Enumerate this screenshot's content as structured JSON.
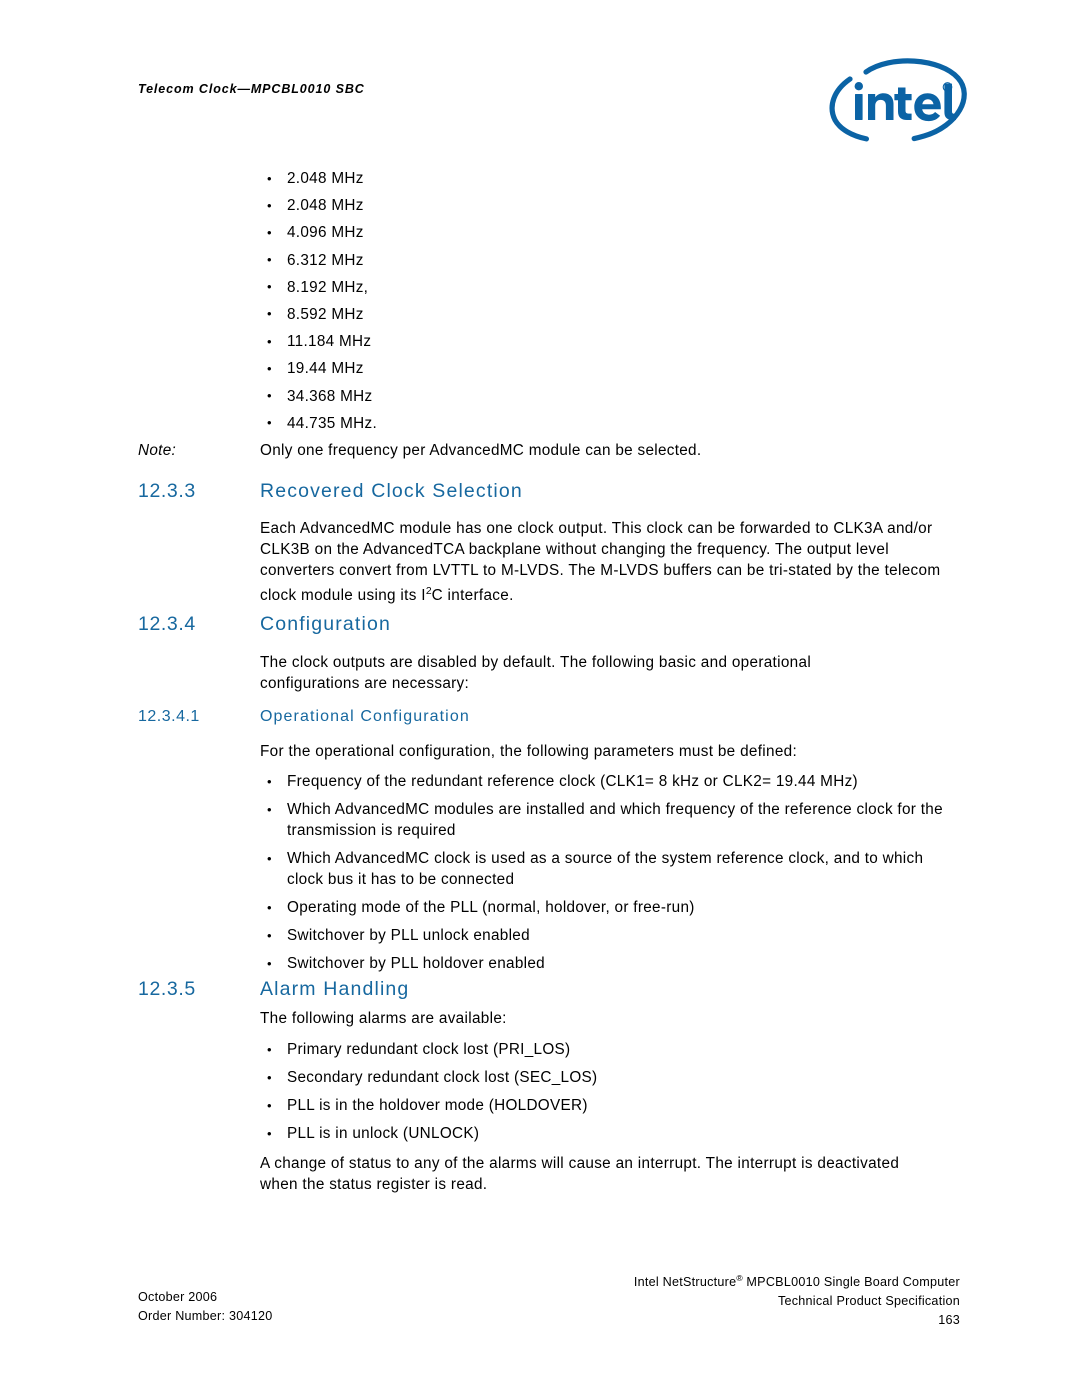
{
  "header": {
    "running_head": "Telecom Clock—MPCBL0010 SBC",
    "logo_alt": "intel",
    "logo_color": "#0b63a5"
  },
  "frequency_list": [
    "2.048 MHz",
    "2.048 MHz",
    "4.096 MHz",
    "6.312 MHz",
    "8.192 MHz,",
    "8.592 MHz",
    "11.184 MHz",
    "19.44 MHz",
    "34.368 MHz",
    "44.735 MHz."
  ],
  "note": {
    "label": "Note:",
    "text": "Only one frequency per AdvancedMC module can be selected."
  },
  "sections": {
    "recovered_clock": {
      "number": "12.3.3",
      "title": "Recovered Clock Selection",
      "paragraph_pre": "Each AdvancedMC module has one clock output. This clock can be forwarded to CLK3A and/or CLK3B on the AdvancedTCA backplane without changing the frequency. The output level converters convert from LVTTL to M-LVDS. The M-LVDS buffers can be tri-stated by the telecom clock module using its I",
      "paragraph_sup": "2",
      "paragraph_post": "C interface."
    },
    "configuration": {
      "number": "12.3.4",
      "title": "Configuration",
      "paragraph": "The clock outputs are disabled by default. The following basic and operational configurations are necessary:"
    },
    "operational_configuration": {
      "number": "12.3.4.1",
      "title": "Operational Configuration",
      "paragraph": "For the operational configuration, the following parameters must be defined:",
      "bullets": [
        "Frequency of the redundant reference clock (CLK1= 8 kHz or CLK2= 19.44 MHz)",
        "Which AdvancedMC modules are installed and which frequency of the reference clock for the transmission is required",
        "Which AdvancedMC clock is used as a source of the system reference clock, and to which clock bus it has to be connected",
        "Operating mode of the PLL (normal, holdover, or free-run)",
        "Switchover by PLL unlock enabled",
        "Switchover by PLL holdover enabled"
      ]
    },
    "alarm_handling": {
      "number": "12.3.5",
      "title": "Alarm Handling",
      "intro": "The following alarms are available:",
      "bullets": [
        "Primary redundant clock lost (PRI_LOS)",
        "Secondary redundant clock lost (SEC_LOS)",
        "PLL is in the holdover mode (HOLDOVER)",
        "PLL is in unlock (UNLOCK)"
      ],
      "closing_paragraph": "A change of status to any of the alarms will cause an interrupt. The interrupt is deactivated when the status register is read."
    }
  },
  "footer": {
    "date": "October 2006",
    "order_number": "Order Number: 304120",
    "product_pre": "Intel NetStructure",
    "product_sup": "®",
    "product_post": " MPCBL0010 Single Board Computer",
    "doc_type": "Technical Product Specification",
    "page_number": "163"
  }
}
